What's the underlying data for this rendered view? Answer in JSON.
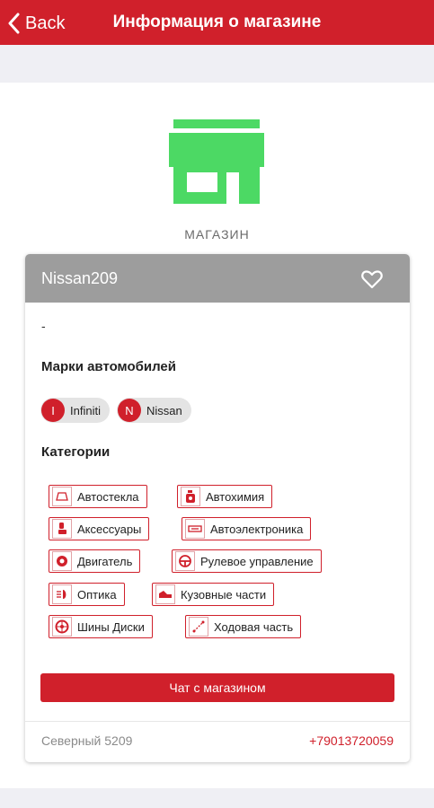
{
  "colors": {
    "primary": "#d0202b",
    "store_icon": "#4cd964",
    "header_gray": "#9d9d9d",
    "background": "#efeff4"
  },
  "nav": {
    "back_label": "Back",
    "title": "Информация о магазине",
    "back_icon": "chevron-left-icon"
  },
  "store": {
    "icon": "storefront-icon",
    "type_label": "МАГАЗИН"
  },
  "card": {
    "shop_name": "Nissan209",
    "favorite_icon": "heart-outline-icon",
    "description": "-",
    "brands_title": "Марки автомобилей",
    "brands": [
      {
        "initial": "I",
        "label": "Infiniti"
      },
      {
        "initial": "N",
        "label": "Nissan"
      }
    ],
    "categories_title": "Категории",
    "categories": [
      {
        "label": "Автостекла",
        "icon": "windshield-icon"
      },
      {
        "label": "Автохимия",
        "icon": "chemical-bottle-icon"
      },
      {
        "label": "Аксессуары",
        "icon": "car-seat-icon"
      },
      {
        "label": "Автоэлектроника",
        "icon": "electronics-icon"
      },
      {
        "label": "Двигатель",
        "icon": "engine-icon"
      },
      {
        "label": "Рулевое управление",
        "icon": "steering-wheel-icon"
      },
      {
        "label": "Оптика",
        "icon": "headlight-icon"
      },
      {
        "label": "Кузовные части",
        "icon": "car-body-icon"
      },
      {
        "label": "Шины Диски",
        "icon": "wheel-icon"
      },
      {
        "label": "Ходовая часть",
        "icon": "suspension-icon"
      }
    ],
    "chat_button": "Чат с магазином",
    "address": "Северный 5209",
    "phone": "+79013720059"
  }
}
